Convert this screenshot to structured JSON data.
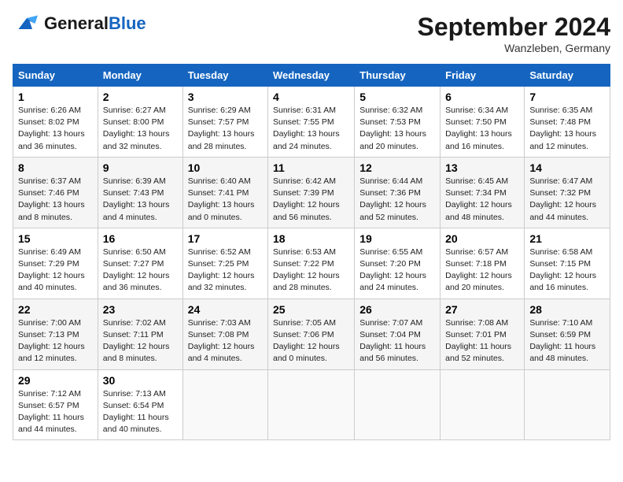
{
  "header": {
    "logo_general": "General",
    "logo_blue": "Blue",
    "month": "September 2024",
    "location": "Wanzleben, Germany"
  },
  "days_of_week": [
    "Sunday",
    "Monday",
    "Tuesday",
    "Wednesday",
    "Thursday",
    "Friday",
    "Saturday"
  ],
  "weeks": [
    [
      {
        "day": "1",
        "info": "Sunrise: 6:26 AM\nSunset: 8:02 PM\nDaylight: 13 hours\nand 36 minutes."
      },
      {
        "day": "2",
        "info": "Sunrise: 6:27 AM\nSunset: 8:00 PM\nDaylight: 13 hours\nand 32 minutes."
      },
      {
        "day": "3",
        "info": "Sunrise: 6:29 AM\nSunset: 7:57 PM\nDaylight: 13 hours\nand 28 minutes."
      },
      {
        "day": "4",
        "info": "Sunrise: 6:31 AM\nSunset: 7:55 PM\nDaylight: 13 hours\nand 24 minutes."
      },
      {
        "day": "5",
        "info": "Sunrise: 6:32 AM\nSunset: 7:53 PM\nDaylight: 13 hours\nand 20 minutes."
      },
      {
        "day": "6",
        "info": "Sunrise: 6:34 AM\nSunset: 7:50 PM\nDaylight: 13 hours\nand 16 minutes."
      },
      {
        "day": "7",
        "info": "Sunrise: 6:35 AM\nSunset: 7:48 PM\nDaylight: 13 hours\nand 12 minutes."
      }
    ],
    [
      {
        "day": "8",
        "info": "Sunrise: 6:37 AM\nSunset: 7:46 PM\nDaylight: 13 hours\nand 8 minutes."
      },
      {
        "day": "9",
        "info": "Sunrise: 6:39 AM\nSunset: 7:43 PM\nDaylight: 13 hours\nand 4 minutes."
      },
      {
        "day": "10",
        "info": "Sunrise: 6:40 AM\nSunset: 7:41 PM\nDaylight: 13 hours\nand 0 minutes."
      },
      {
        "day": "11",
        "info": "Sunrise: 6:42 AM\nSunset: 7:39 PM\nDaylight: 12 hours\nand 56 minutes."
      },
      {
        "day": "12",
        "info": "Sunrise: 6:44 AM\nSunset: 7:36 PM\nDaylight: 12 hours\nand 52 minutes."
      },
      {
        "day": "13",
        "info": "Sunrise: 6:45 AM\nSunset: 7:34 PM\nDaylight: 12 hours\nand 48 minutes."
      },
      {
        "day": "14",
        "info": "Sunrise: 6:47 AM\nSunset: 7:32 PM\nDaylight: 12 hours\nand 44 minutes."
      }
    ],
    [
      {
        "day": "15",
        "info": "Sunrise: 6:49 AM\nSunset: 7:29 PM\nDaylight: 12 hours\nand 40 minutes."
      },
      {
        "day": "16",
        "info": "Sunrise: 6:50 AM\nSunset: 7:27 PM\nDaylight: 12 hours\nand 36 minutes."
      },
      {
        "day": "17",
        "info": "Sunrise: 6:52 AM\nSunset: 7:25 PM\nDaylight: 12 hours\nand 32 minutes."
      },
      {
        "day": "18",
        "info": "Sunrise: 6:53 AM\nSunset: 7:22 PM\nDaylight: 12 hours\nand 28 minutes."
      },
      {
        "day": "19",
        "info": "Sunrise: 6:55 AM\nSunset: 7:20 PM\nDaylight: 12 hours\nand 24 minutes."
      },
      {
        "day": "20",
        "info": "Sunrise: 6:57 AM\nSunset: 7:18 PM\nDaylight: 12 hours\nand 20 minutes."
      },
      {
        "day": "21",
        "info": "Sunrise: 6:58 AM\nSunset: 7:15 PM\nDaylight: 12 hours\nand 16 minutes."
      }
    ],
    [
      {
        "day": "22",
        "info": "Sunrise: 7:00 AM\nSunset: 7:13 PM\nDaylight: 12 hours\nand 12 minutes."
      },
      {
        "day": "23",
        "info": "Sunrise: 7:02 AM\nSunset: 7:11 PM\nDaylight: 12 hours\nand 8 minutes."
      },
      {
        "day": "24",
        "info": "Sunrise: 7:03 AM\nSunset: 7:08 PM\nDaylight: 12 hours\nand 4 minutes."
      },
      {
        "day": "25",
        "info": "Sunrise: 7:05 AM\nSunset: 7:06 PM\nDaylight: 12 hours\nand 0 minutes."
      },
      {
        "day": "26",
        "info": "Sunrise: 7:07 AM\nSunset: 7:04 PM\nDaylight: 11 hours\nand 56 minutes."
      },
      {
        "day": "27",
        "info": "Sunrise: 7:08 AM\nSunset: 7:01 PM\nDaylight: 11 hours\nand 52 minutes."
      },
      {
        "day": "28",
        "info": "Sunrise: 7:10 AM\nSunset: 6:59 PM\nDaylight: 11 hours\nand 48 minutes."
      }
    ],
    [
      {
        "day": "29",
        "info": "Sunrise: 7:12 AM\nSunset: 6:57 PM\nDaylight: 11 hours\nand 44 minutes."
      },
      {
        "day": "30",
        "info": "Sunrise: 7:13 AM\nSunset: 6:54 PM\nDaylight: 11 hours\nand 40 minutes."
      },
      {
        "day": "",
        "info": ""
      },
      {
        "day": "",
        "info": ""
      },
      {
        "day": "",
        "info": ""
      },
      {
        "day": "",
        "info": ""
      },
      {
        "day": "",
        "info": ""
      }
    ]
  ]
}
